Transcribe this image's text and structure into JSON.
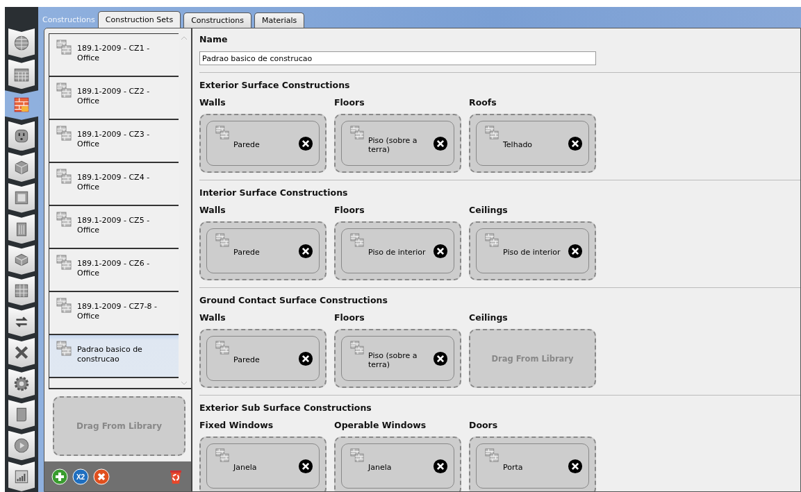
{
  "nav_items": [
    {
      "selected": false
    },
    {
      "selected": false
    },
    {
      "selected": true
    },
    {
      "selected": false
    },
    {
      "selected": false
    },
    {
      "selected": false
    },
    {
      "selected": false
    },
    {
      "selected": false
    },
    {
      "selected": false
    },
    {
      "selected": false
    },
    {
      "selected": false
    },
    {
      "selected": false
    },
    {
      "selected": false
    },
    {
      "selected": false
    },
    {
      "selected": false
    }
  ],
  "header_label": "Constructions",
  "tabs": [
    {
      "label": "Construction Sets",
      "selected": true
    },
    {
      "label": "Constructions",
      "selected": false
    },
    {
      "label": "Materials",
      "selected": false
    }
  ],
  "list_items": [
    {
      "name": "189.1-2009 - CZ1 - Office",
      "selected": false
    },
    {
      "name": "189.1-2009 - CZ2 - Office",
      "selected": false
    },
    {
      "name": "189.1-2009 - CZ3 - Office",
      "selected": false
    },
    {
      "name": "189.1-2009 - CZ4 - Office",
      "selected": false
    },
    {
      "name": "189.1-2009 - CZ5 - Office",
      "selected": false
    },
    {
      "name": "189.1-2009 - CZ6 - Office",
      "selected": false
    },
    {
      "name": "189.1-2009 - CZ7-8 - Office",
      "selected": false
    },
    {
      "name": "Padrao basico de construcao",
      "selected": true
    }
  ],
  "list_drop_zone": "Drag From Library",
  "copy_button_label": "X2",
  "name_label": "Name",
  "name_value": "Padrao basico de construcao",
  "sections": [
    {
      "title": "Exterior Surface Constructions",
      "slots": [
        {
          "label": "Walls",
          "kind": "filled",
          "text": "Parede"
        },
        {
          "label": "Floors",
          "kind": "filled",
          "text": "Piso (sobre a terra)"
        },
        {
          "label": "Roofs",
          "kind": "filled",
          "text": "Telhado"
        }
      ]
    },
    {
      "title": "Interior Surface Constructions",
      "slots": [
        {
          "label": "Walls",
          "kind": "filled",
          "text": "Parede"
        },
        {
          "label": "Floors",
          "kind": "filled",
          "text": "Piso de interior"
        },
        {
          "label": "Ceilings",
          "kind": "filled",
          "text": "Piso de interior"
        }
      ]
    },
    {
      "title": "Ground Contact Surface Constructions",
      "slots": [
        {
          "label": "Walls",
          "kind": "filled",
          "text": "Parede"
        },
        {
          "label": "Floors",
          "kind": "filled",
          "text": "Piso (sobre a terra)"
        },
        {
          "label": "Ceilings",
          "kind": "empty",
          "text": "Drag From Library"
        }
      ]
    },
    {
      "title": "Exterior Sub Surface Constructions",
      "slots": [
        {
          "label": "Fixed Windows",
          "kind": "filled",
          "text": "Janela"
        },
        {
          "label": "Operable Windows",
          "kind": "filled",
          "text": "Janela"
        },
        {
          "label": "Doors",
          "kind": "filled",
          "text": "Porta"
        }
      ]
    }
  ]
}
